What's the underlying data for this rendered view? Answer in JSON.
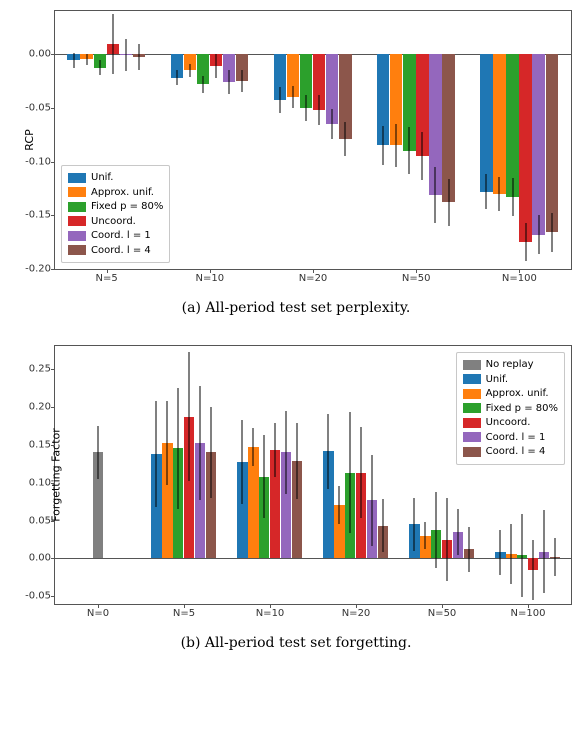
{
  "caption_a": "(a) All-period test set perplexity.",
  "caption_b": "(b) All-period test set forgetting.",
  "chart_data": [
    {
      "id": "a",
      "type": "bar",
      "ylabel": "RCP",
      "ylim": [
        -0.2,
        0.04
      ],
      "yticks": [
        -0.2,
        -0.15,
        -0.1,
        -0.05,
        0.0
      ],
      "categories": [
        "N=5",
        "N=10",
        "N=20",
        "N=50",
        "N=100"
      ],
      "series": [
        {
          "name": "Unif.",
          "color": "#1f77b4",
          "values": [
            -0.006,
            -0.022,
            -0.043,
            -0.085,
            -0.128
          ],
          "err": [
            0.007,
            0.007,
            0.012,
            0.018,
            0.016
          ]
        },
        {
          "name": "Approx. unif.",
          "color": "#ff7f0e",
          "values": [
            -0.005,
            -0.015,
            -0.04,
            -0.085,
            -0.13
          ],
          "err": [
            0.005,
            0.006,
            0.01,
            0.02,
            0.016
          ]
        },
        {
          "name": "Fixed p = 80%",
          "color": "#2ca02c",
          "values": [
            -0.013,
            -0.028,
            -0.05,
            -0.09,
            -0.133
          ],
          "err": [
            0.007,
            0.008,
            0.012,
            0.022,
            0.018
          ]
        },
        {
          "name": "Uncoord.",
          "color": "#d62728",
          "values": [
            0.009,
            -0.011,
            -0.052,
            -0.095,
            -0.175
          ],
          "err": [
            0.028,
            0.011,
            0.014,
            0.022,
            0.018
          ]
        },
        {
          "name": "Coord. l = 1",
          "color": "#9467bd",
          "values": [
            -0.001,
            -0.026,
            -0.065,
            -0.131,
            -0.168
          ],
          "err": [
            0.015,
            0.011,
            0.014,
            0.026,
            0.018
          ]
        },
        {
          "name": "Coord. l = 4",
          "color": "#8c564b",
          "values": [
            -0.003,
            -0.025,
            -0.079,
            -0.138,
            -0.166
          ],
          "err": [
            0.012,
            0.01,
            0.016,
            0.022,
            0.018
          ]
        }
      ],
      "legend_pos": "lower-left"
    },
    {
      "id": "b",
      "type": "bar",
      "ylabel": "Forgetting Factor",
      "ylim": [
        -0.06,
        0.28
      ],
      "yticks": [
        -0.05,
        0.0,
        0.05,
        0.1,
        0.15,
        0.2,
        0.25
      ],
      "categories": [
        "N=0",
        "N=5",
        "N=10",
        "N=20",
        "N=50",
        "N=100"
      ],
      "series": [
        {
          "name": "No replay",
          "color": "#808080",
          "values": [
            0.14,
            null,
            null,
            null,
            null,
            null
          ],
          "err": [
            0.035,
            null,
            null,
            null,
            null,
            null
          ]
        },
        {
          "name": "Unif.",
          "color": "#1f77b4",
          "values": [
            null,
            0.138,
            0.127,
            0.141,
            0.045,
            0.008
          ],
          "err": [
            null,
            0.07,
            0.055,
            0.05,
            0.035,
            0.03
          ]
        },
        {
          "name": "Approx. unif.",
          "color": "#ff7f0e",
          "values": [
            null,
            0.152,
            0.147,
            0.071,
            0.03,
            0.006
          ],
          "err": [
            null,
            0.055,
            0.025,
            0.025,
            0.018,
            0.04
          ]
        },
        {
          "name": "Fixed p = 80%",
          "color": "#2ca02c",
          "values": [
            null,
            0.145,
            0.108,
            0.113,
            0.038,
            0.004
          ],
          "err": [
            null,
            0.08,
            0.055,
            0.08,
            0.05,
            0.055
          ]
        },
        {
          "name": "Uncoord.",
          "color": "#d62728",
          "values": [
            null,
            0.187,
            0.143,
            0.113,
            0.025,
            -0.015
          ],
          "err": [
            null,
            0.085,
            0.035,
            0.06,
            0.055,
            0.04
          ]
        },
        {
          "name": "Coord. l = 1",
          "color": "#9467bd",
          "values": [
            null,
            0.152,
            0.14,
            0.077,
            0.035,
            0.009
          ],
          "err": [
            null,
            0.075,
            0.055,
            0.06,
            0.03,
            0.055
          ]
        },
        {
          "name": "Coord. l = 4",
          "color": "#8c564b",
          "values": [
            null,
            0.14,
            0.128,
            0.043,
            0.012,
            0.002
          ],
          "err": [
            null,
            0.06,
            0.05,
            0.035,
            0.03,
            0.025
          ]
        }
      ],
      "legend_pos": "upper-right"
    }
  ]
}
